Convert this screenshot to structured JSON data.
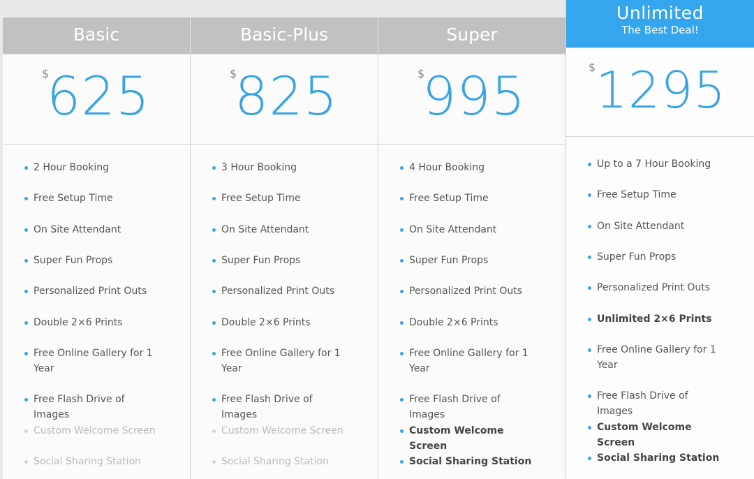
{
  "plans": [
    {
      "name": "Basic",
      "currency": "$",
      "price": "625",
      "features": [
        {
          "text": "2 Hour Booking",
          "state": "normal"
        },
        {
          "text": "Free Setup Time",
          "state": "normal"
        },
        {
          "text": "On Site Attendant",
          "state": "normal"
        },
        {
          "text": "Super Fun Props",
          "state": "normal"
        },
        {
          "text": "Personalized Print Outs",
          "state": "normal"
        },
        {
          "text": "Double 2×6 Prints",
          "state": "normal"
        },
        {
          "text": "Free Online Gallery for 1 Year",
          "state": "normal"
        },
        {
          "text": "Free Flash Drive of Images",
          "state": "normal"
        },
        {
          "text": "Custom Welcome Screen",
          "state": "disabled"
        },
        {
          "text": "Social Sharing Station",
          "state": "disabled"
        }
      ]
    },
    {
      "name": "Basic-Plus",
      "currency": "$",
      "price": "825",
      "features": [
        {
          "text": "3 Hour Booking",
          "state": "normal"
        },
        {
          "text": "Free Setup Time",
          "state": "normal"
        },
        {
          "text": "On Site Attendant",
          "state": "normal"
        },
        {
          "text": "Super Fun Props",
          "state": "normal"
        },
        {
          "text": "Personalized Print Outs",
          "state": "normal"
        },
        {
          "text": "Double 2×6 Prints",
          "state": "normal"
        },
        {
          "text": "Free Online Gallery for 1 Year",
          "state": "normal"
        },
        {
          "text": "Free Flash Drive of Images",
          "state": "normal"
        },
        {
          "text": "Custom Welcome Screen",
          "state": "disabled"
        },
        {
          "text": "Social Sharing Station",
          "state": "disabled"
        }
      ]
    },
    {
      "name": "Super",
      "currency": "$",
      "price": "995",
      "features": [
        {
          "text": "4 Hour Booking",
          "state": "normal"
        },
        {
          "text": "Free Setup Time",
          "state": "normal"
        },
        {
          "text": "On Site Attendant",
          "state": "normal"
        },
        {
          "text": "Super Fun Props",
          "state": "normal"
        },
        {
          "text": "Personalized Print Outs",
          "state": "normal"
        },
        {
          "text": "Double 2×6 Prints",
          "state": "normal"
        },
        {
          "text": "Free Online Gallery for 1 Year",
          "state": "normal"
        },
        {
          "text": "Free Flash Drive of Images",
          "state": "normal"
        },
        {
          "text": "Custom Welcome Screen",
          "state": "bold"
        },
        {
          "text": "Social Sharing Station",
          "state": "bold"
        }
      ]
    }
  ],
  "featured_plan": {
    "name": "Unlimited",
    "subtitle": "The Best Deal!",
    "currency": "$",
    "price": "1295",
    "features": [
      {
        "text": "Up to a 7 Hour Booking",
        "state": "normal"
      },
      {
        "text": "Free Setup Time",
        "state": "normal"
      },
      {
        "text": "On Site Attendant",
        "state": "normal"
      },
      {
        "text": "Super Fun Props",
        "state": "normal"
      },
      {
        "text": "Personalized Print Outs",
        "state": "normal"
      },
      {
        "text": "Unlimited 2×6 Prints",
        "state": "bold"
      },
      {
        "text": "Free Online Gallery for 1 Year",
        "state": "normal"
      },
      {
        "text": "Free Flash Drive of Images",
        "state": "normal"
      },
      {
        "text": "Custom Welcome Screen",
        "state": "bold"
      },
      {
        "text": "Social Sharing Station",
        "state": "bold"
      }
    ]
  },
  "colors": {
    "header_gray": "#c1c1c1",
    "featured_blue": "#35a6ee",
    "price_blue": "#38a3e6",
    "bullet_blue": "#3ba2e4",
    "disabled_text": "#bbbbbb"
  }
}
